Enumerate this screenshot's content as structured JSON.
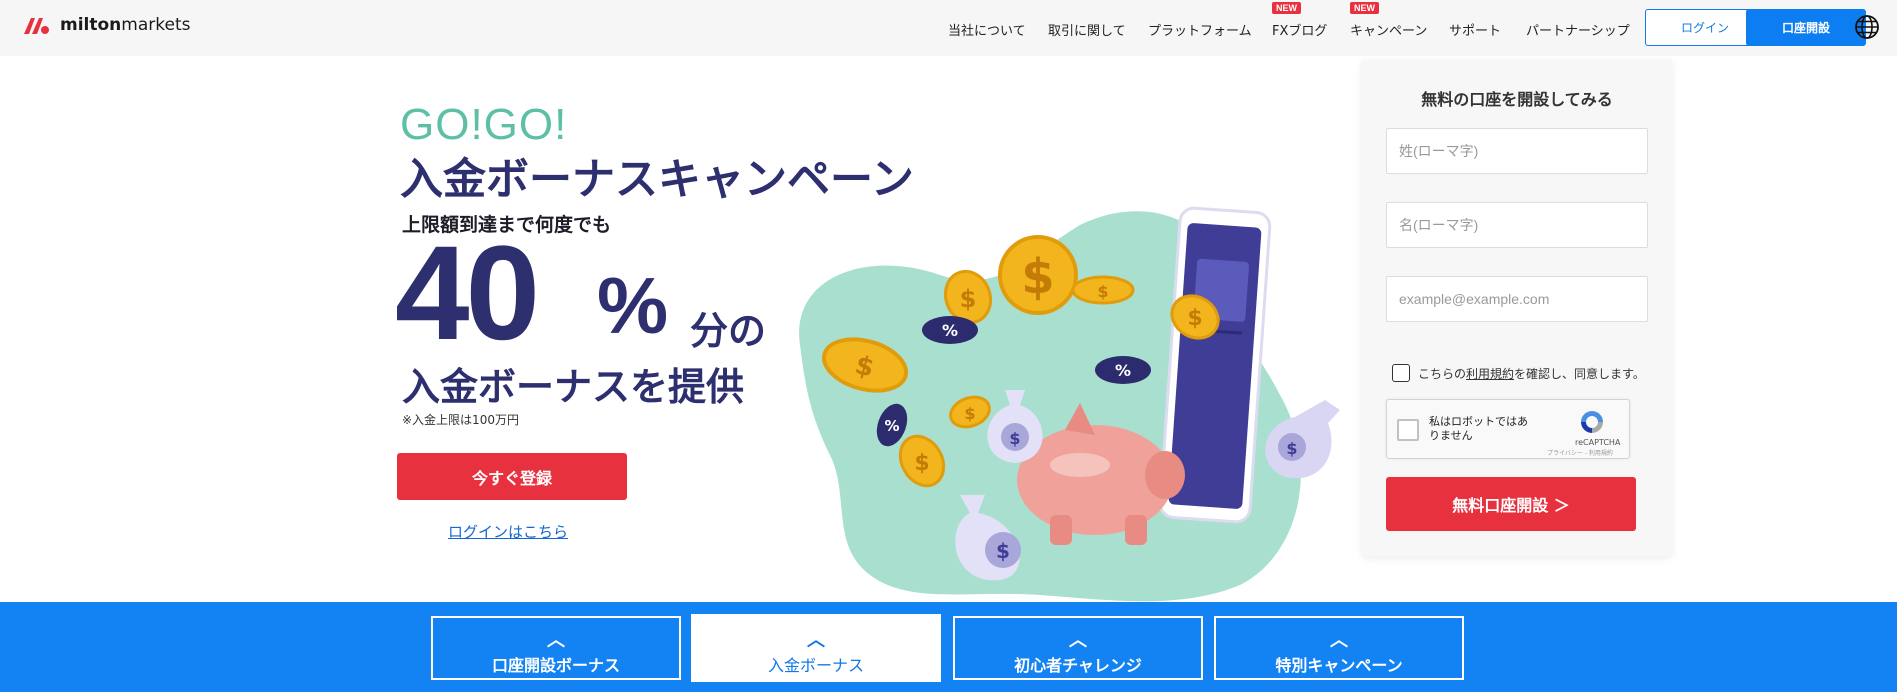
{
  "header": {
    "logo_text_bold": "milton",
    "logo_text": "markets",
    "nav": [
      {
        "label": "当社について",
        "new": false
      },
      {
        "label": "取引に関して",
        "new": false
      },
      {
        "label": "プラットフォーム",
        "new": false
      },
      {
        "label": "FXブログ",
        "new": true
      },
      {
        "label": "キャンペーン",
        "new": true
      },
      {
        "label": "サポート",
        "new": false
      },
      {
        "label": "パートナーシップ",
        "new": false
      }
    ],
    "new_badge": "NEW",
    "login_label": "ログイン",
    "open_label": "口座開設"
  },
  "hero": {
    "gogo": "GO!GO!",
    "headline": "入金ボーナスキャンペーン",
    "sub": "上限額到達まで何度でも",
    "big_number": "40",
    "percent": "%",
    "bunno": "分の",
    "provide": "入金ボーナスを提供",
    "note": "※入金上限は100万円",
    "register_label": "今すぐ登録",
    "login_link": "ログインはこちら"
  },
  "illustration": {
    "dollar": "$",
    "percent": "%"
  },
  "form": {
    "title": "無料の口座を開設してみる",
    "last_name_placeholder": "姓(ローマ字)",
    "first_name_placeholder": "名(ローマ字)",
    "email_placeholder": "example@example.com",
    "agree_prefix": "こちらの",
    "agree_terms": "利用規約",
    "agree_suffix": "を確認し、同意します。",
    "recaptcha_label": "私はロボットではありません",
    "recaptcha_brand": "reCAPTCHA",
    "recaptcha_terms": "プライバシー - 利用規約",
    "submit_label": "無料口座開設 ＞"
  },
  "tabs": [
    {
      "label": "口座開設ボーナス",
      "active": false
    },
    {
      "label": "入金ボーナス",
      "active": true
    },
    {
      "label": "初心者チャレンジ",
      "active": false
    },
    {
      "label": "特別キャンペーン",
      "active": false
    }
  ],
  "colors": {
    "brand_red": "#e8313f",
    "brand_blue": "#1382f2",
    "navy": "#2e2f6e",
    "teal": "#5cbfa6"
  }
}
